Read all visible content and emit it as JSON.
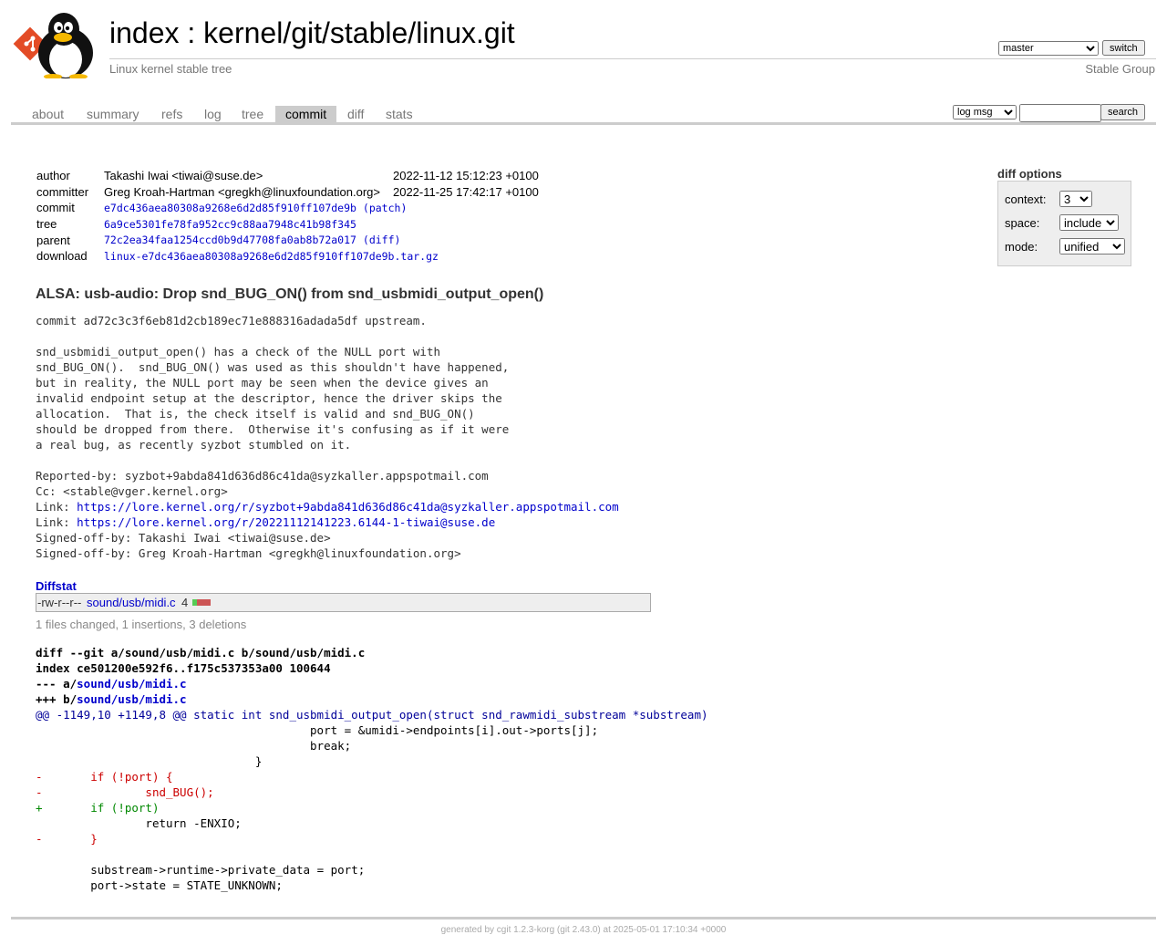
{
  "header": {
    "title_prefix": "index",
    "title_sep": " : ",
    "repo_path": "kernel/git/stable/linux.git",
    "description": "Linux kernel stable tree",
    "owner": "Stable Group",
    "branch_selected": "master",
    "switch_label": "switch"
  },
  "tabs": [
    "about",
    "summary",
    "refs",
    "log",
    "tree",
    "commit",
    "diff",
    "stats"
  ],
  "active_tab": "commit",
  "search": {
    "mode": "log msg",
    "value": "",
    "button": "search"
  },
  "commit_info": {
    "author_label": "author",
    "author": "Takashi Iwai <tiwai@suse.de>",
    "author_date": "2022-11-12 15:12:23 +0100",
    "committer_label": "committer",
    "committer": "Greg Kroah-Hartman <gregkh@linuxfoundation.org>",
    "committer_date": "2022-11-25 17:42:17 +0100",
    "commit_label": "commit",
    "commit": "e7dc436aea80308a9268e6d2d85f910ff107de9b",
    "patch_open": " (",
    "patch_label": "patch",
    "patch_close": ")",
    "tree_label": "tree",
    "tree": "6a9ce5301fe78fa952cc9c88aa7948c41b98f345",
    "parent_label": "parent",
    "parent": "72c2ea34faa1254ccd0b9d47708fa0ab8b72a017",
    "parent_diff_open": " (",
    "parent_diff_label": "diff",
    "parent_diff_close": ")",
    "download_label": "download",
    "download": "linux-e7dc436aea80308a9268e6d2d85f910ff107de9b.tar.gz"
  },
  "diff_options": {
    "title": "diff options",
    "context_label": "context:",
    "context_value": "3",
    "space_label": "space:",
    "space_value": "include",
    "mode_label": "mode:",
    "mode_value": "unified"
  },
  "message": {
    "subject": "ALSA: usb-audio: Drop snd_BUG_ON() from snd_usbmidi_output_open()",
    "body_lines": [
      "commit ad72c3c3f6eb81d2cb189ec71e888316adada5df upstream.",
      "",
      "snd_usbmidi_output_open() has a check of the NULL port with",
      "snd_BUG_ON().  snd_BUG_ON() was used as this shouldn't have happened,",
      "but in reality, the NULL port may be seen when the device gives an",
      "invalid endpoint setup at the descriptor, hence the driver skips the",
      "allocation.  That is, the check itself is valid and snd_BUG_ON()",
      "should be dropped from there.  Otherwise it's confusing as if it were",
      "a real bug, as recently syzbot stumbled on it.",
      "",
      "Reported-by: syzbot+9abda841d636d86c41da@syzkaller.appspotmail.com",
      "Cc: <stable@vger.kernel.org>"
    ],
    "link_prefix": "Link: ",
    "links": [
      "https://lore.kernel.org/r/syzbot+9abda841d636d86c41da@syzkaller.appspotmail.com",
      "https://lore.kernel.org/r/20221112141223.6144-1-tiwai@suse.de"
    ],
    "signoff_lines": [
      "Signed-off-by: Takashi Iwai <tiwai@suse.de>",
      "Signed-off-by: Greg Kroah-Hartman <gregkh@linuxfoundation.org>"
    ]
  },
  "diffstat": {
    "title": "Diffstat",
    "mode": "-rw-r--r--",
    "file": "sound/usb/midi.c",
    "changes": "4",
    "insertions": 1,
    "deletions": 3,
    "summary": "1 files changed, 1 insertions, 3 deletions"
  },
  "diff": {
    "header_line1": "diff --git a/sound/usb/midi.c b/sound/usb/midi.c",
    "header_line2": "index ce501200e592f6..f175c537353a00 100644",
    "minus_prefix": "--- a/",
    "plus_prefix": "+++ b/",
    "file": "sound/usb/midi.c",
    "hunk": "@@ -1149,10 +1149,8 @@ static int snd_usbmidi_output_open(struct snd_rawmidi_substream *substream)",
    "lines": [
      {
        "type": "ctx",
        "text": " \t\t\t\t\tport = &umidi->endpoints[i].out->ports[j];"
      },
      {
        "type": "ctx",
        "text": " \t\t\t\t\tbreak;"
      },
      {
        "type": "ctx",
        "text": " \t\t\t\t}"
      },
      {
        "type": "del",
        "text": "-\tif (!port) {"
      },
      {
        "type": "del",
        "text": "-\t\tsnd_BUG();"
      },
      {
        "type": "add",
        "text": "+\tif (!port)"
      },
      {
        "type": "ctx",
        "text": " \t\treturn -ENXIO;"
      },
      {
        "type": "del",
        "text": "-\t}"
      },
      {
        "type": "ctx",
        "text": " "
      },
      {
        "type": "ctx",
        "text": " \tsubstream->runtime->private_data = port;"
      },
      {
        "type": "ctx",
        "text": " \tport->state = STATE_UNKNOWN;"
      }
    ]
  },
  "footer": "generated by cgit 1.2.3-korg (git 2.43.0) at 2025-05-01 17:10:34 +0000",
  "colors": {
    "link": "#0000cc",
    "deletion": "#cc0000",
    "addition": "#008800",
    "hunk": "#000099",
    "tab_active_bg": "#cccccc"
  }
}
